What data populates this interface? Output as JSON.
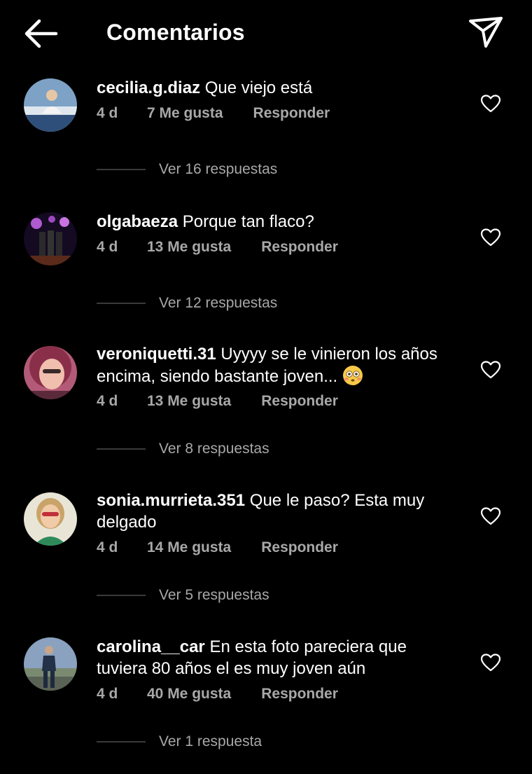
{
  "header": {
    "title": "Comentarios",
    "back_icon": "arrow-left-icon",
    "send_icon": "paper-plane-icon"
  },
  "comments": [
    {
      "username": "cecilia.g.diaz",
      "text": "Que viejo está",
      "time": "4 d",
      "likes": "7 Me gusta",
      "reply": "Responder",
      "view_replies": "Ver 16 respuestas",
      "avatar_colors": [
        "#6b8fb8",
        "#dfe7ee",
        "#2e4f7a"
      ]
    },
    {
      "username": "olgabaeza",
      "text": "Porque tan flaco?",
      "time": "4 d",
      "likes": "13 Me gusta",
      "reply": "Responder",
      "view_replies": "Ver 12 respuestas",
      "avatar_colors": [
        "#1a0f2a",
        "#b05ad0",
        "#3a2130"
      ]
    },
    {
      "username": "veroniquetti.31",
      "text": "Uyyyy se le vinieron  los años encima, siendo bastante joven... ",
      "emoji": "flushed-face-emoji",
      "time": "4 d",
      "likes": "13 Me gusta",
      "reply": "Responder",
      "view_replies": "Ver 8 respuestas",
      "avatar_colors": [
        "#d98aa0",
        "#8a2f4a",
        "#f3c1b0"
      ]
    },
    {
      "username": "sonia.murrieta.351",
      "text": "Que le paso? Esta muy delgado",
      "time": "4 d",
      "likes": "14 Me gusta",
      "reply": "Responder",
      "view_replies": "Ver 5 respuestas",
      "avatar_colors": [
        "#e6e2d2",
        "#c9a46a",
        "#2f8a5a"
      ]
    },
    {
      "username": "carolina__car",
      "text": "En esta foto pareciera que tuviera 80 años el es muy joven aún",
      "time": "4 d",
      "likes": "40 Me gusta",
      "reply": "Responder",
      "view_replies": "Ver 1 respuesta",
      "avatar_colors": [
        "#6f86a2",
        "#2e3c55",
        "#9aa48f"
      ]
    }
  ],
  "colors": {
    "background": "#000000",
    "primary_text": "#ffffff",
    "secondary_text": "#a8a8a8"
  }
}
